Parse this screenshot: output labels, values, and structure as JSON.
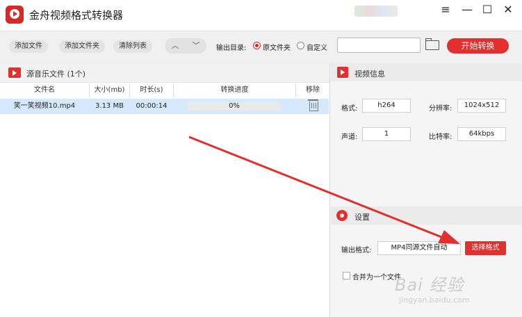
{
  "app": {
    "title": "金舟视频格式转换器",
    "accent": "#e2302e"
  },
  "window_controls": {
    "menu": "≡",
    "minimize": "—",
    "maximize": "☐",
    "close": "✕"
  },
  "toolbar": {
    "add_file": "添加文件",
    "add_folder": "添加文件夹",
    "clear_list": "清除列表",
    "output_dir_label": "输出目录:",
    "option_original": "原文件夹",
    "option_custom": "自定义",
    "output_path": "",
    "start": "开始转换"
  },
  "file_panel": {
    "title": "源音乐文件 (1个)",
    "columns": [
      "文件名",
      "大小(mb)",
      "时长(s)",
      "转换进度",
      "移除"
    ],
    "rows": [
      {
        "name": "笑一笑视频10.mp4",
        "size": "3.13 MB",
        "duration": "00:00:14",
        "progress": "0%",
        "progress_fraction": 0
      }
    ]
  },
  "video_info": {
    "title": "视频信息",
    "format_label": "格式:",
    "format": "h264",
    "resolution_label": "分辨率:",
    "resolution": "1024x512",
    "channels_label": "声道:",
    "channels": "1",
    "bitrate_label": "比特率:",
    "bitrate": "64kbps"
  },
  "settings": {
    "title": "设置",
    "output_format_label": "输出格式:",
    "output_format": "MP4同源文件自动",
    "choose_format": "选择格式",
    "merge_label": "合并为一个文件"
  },
  "watermark": {
    "logo": "Bai 经验",
    "url": "jingyan.baidu.com"
  }
}
